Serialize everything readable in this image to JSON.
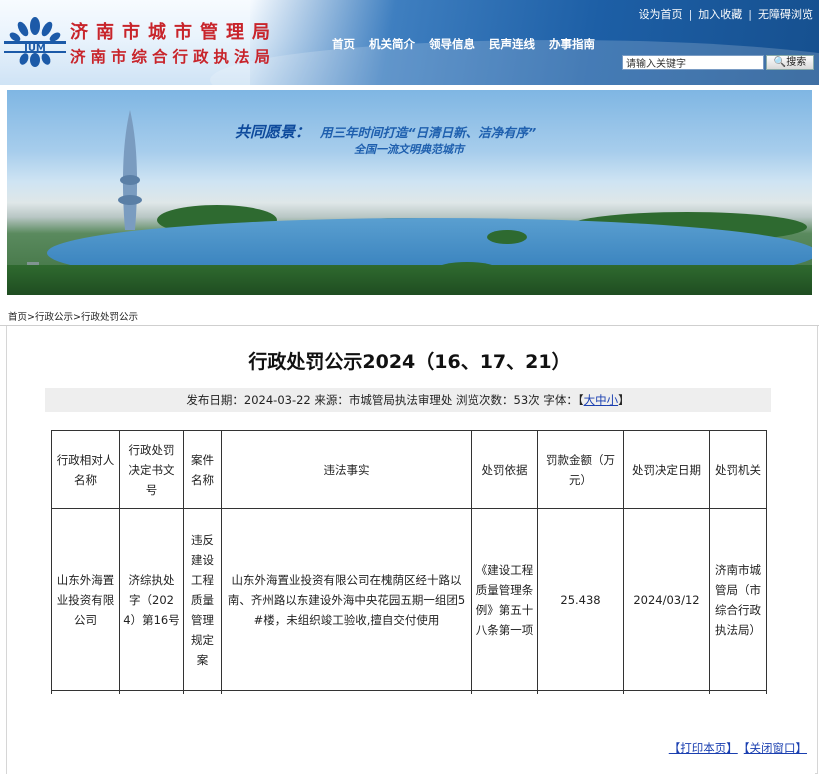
{
  "header": {
    "org_title": "济南市城市管理局",
    "org_subtitle": "济南市综合行政执法局",
    "top_links": [
      "设为首页",
      "加入收藏",
      "无障碍浏览"
    ],
    "nav": [
      "首页",
      "机关简介",
      "领导信息",
      "民声连线",
      "办事指南"
    ],
    "search_placeholder": "请输入关键字",
    "search_button": "搜索",
    "logo_text": "JUM"
  },
  "banner": {
    "slogan_head": "共同愿景：",
    "slogan_line1": "用三年时间打造“日清日新、洁净有序”",
    "slogan_line2": "全国一流文明典范城市"
  },
  "breadcrumb": [
    "首页",
    "行政公示",
    "行政处罚公示"
  ],
  "article": {
    "title": "行政处罚公示2024（16、17、21）",
    "meta_prefix": "发布日期：2024-03-22 来源：市城管局执法审理处 浏览次数：53次 字体：【",
    "font_sizes": [
      "大",
      "中",
      "小"
    ],
    "meta_suffix": "】"
  },
  "table": {
    "headers": [
      "行政相对人名称",
      "行政处罚决定书文号",
      "案件名称",
      "违法事实",
      "处罚依据",
      "罚款金额（万元）",
      "处罚决定日期",
      "处罚机关"
    ],
    "rows": [
      [
        "山东外海置业投资有限公司",
        "济综执处字（2024）第16号",
        "违反建设工程质量管理规定案",
        "山东外海置业投资有限公司在槐荫区经十路以南、齐州路以东建设外海中央花园五期一组团5#楼，未组织竣工验收,擅自交付使用",
        "《建设工程质量管理条例》第五十八条第一项",
        "25.438",
        "2024/03/12",
        "济南市城管局（市综合行政执法局）"
      ]
    ]
  },
  "actions": {
    "print": "【打印本页】",
    "close": "【关闭窗口】"
  },
  "colors": {
    "title_red": "#c8242b",
    "header_blue": "#1d5fa6",
    "link_blue": "#1a3fb0"
  }
}
